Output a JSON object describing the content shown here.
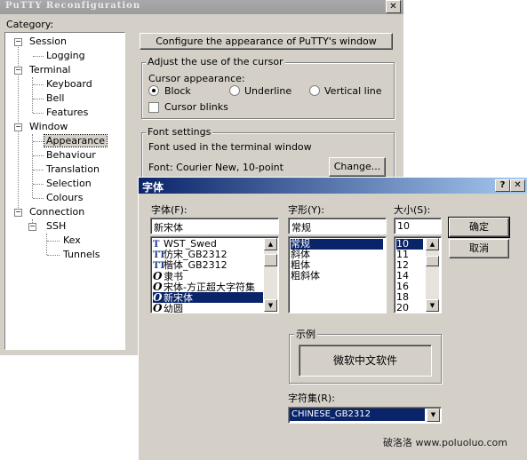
{
  "putty": {
    "title": "PuTTY Reconfiguration",
    "close_glyph": "✕",
    "category_label": "Category:",
    "tree": {
      "session": "Session",
      "logging": "Logging",
      "terminal": "Terminal",
      "keyboard": "Keyboard",
      "bell": "Bell",
      "features": "Features",
      "window": "Window",
      "appearance": "Appearance",
      "behaviour": "Behaviour",
      "translation": "Translation",
      "selection": "Selection",
      "colours": "Colours",
      "connection": "Connection",
      "ssh": "SSH",
      "kex": "Kex",
      "tunnels": "Tunnels"
    },
    "header": "Configure the appearance of PuTTY's window",
    "cursor_group": {
      "title": "Adjust the use of the cursor",
      "appearance_label": "Cursor appearance:",
      "block": "Block",
      "underline": "Underline",
      "vertical_line": "Vertical line",
      "selected": "Block",
      "blinks": "Cursor blinks",
      "blinks_checked": false
    },
    "font_group": {
      "title": "Font settings",
      "used_label": "Font used in the terminal window",
      "current_font": "Font: Courier New, 10-point",
      "change_button": "Change..."
    }
  },
  "font_dialog": {
    "title": "字体",
    "help_glyph": "?",
    "close_glyph": "✕",
    "font_label": "字体(F):",
    "font_value": "新宋体",
    "fonts": [
      "WST_Swed",
      "仿宋_GB2312",
      "楷体_GB2312",
      "隶书",
      "宋体-方正超大字符集",
      "新宋体",
      "幼圆"
    ],
    "font_icons": [
      "T",
      "TT",
      "TT",
      "O",
      "O",
      "O",
      "O"
    ],
    "font_selected": "新宋体",
    "style_label": "字形(Y):",
    "style_value": "常规",
    "styles": [
      "常规",
      "斜体",
      "粗体",
      "粗斜体"
    ],
    "style_selected": "常规",
    "size_label": "大小(S):",
    "size_value": "10",
    "sizes": [
      "10",
      "11",
      "12",
      "14",
      "16",
      "18",
      "20"
    ],
    "size_selected": "10",
    "ok_button": "确定",
    "cancel_button": "取消",
    "sample_group": "示例",
    "sample_text": "微软中文软件",
    "charset_label": "字符集(R):",
    "charset_value": "CHINESE_GB2312"
  },
  "watermark": "破洛洛  www.poluoluo.com"
}
